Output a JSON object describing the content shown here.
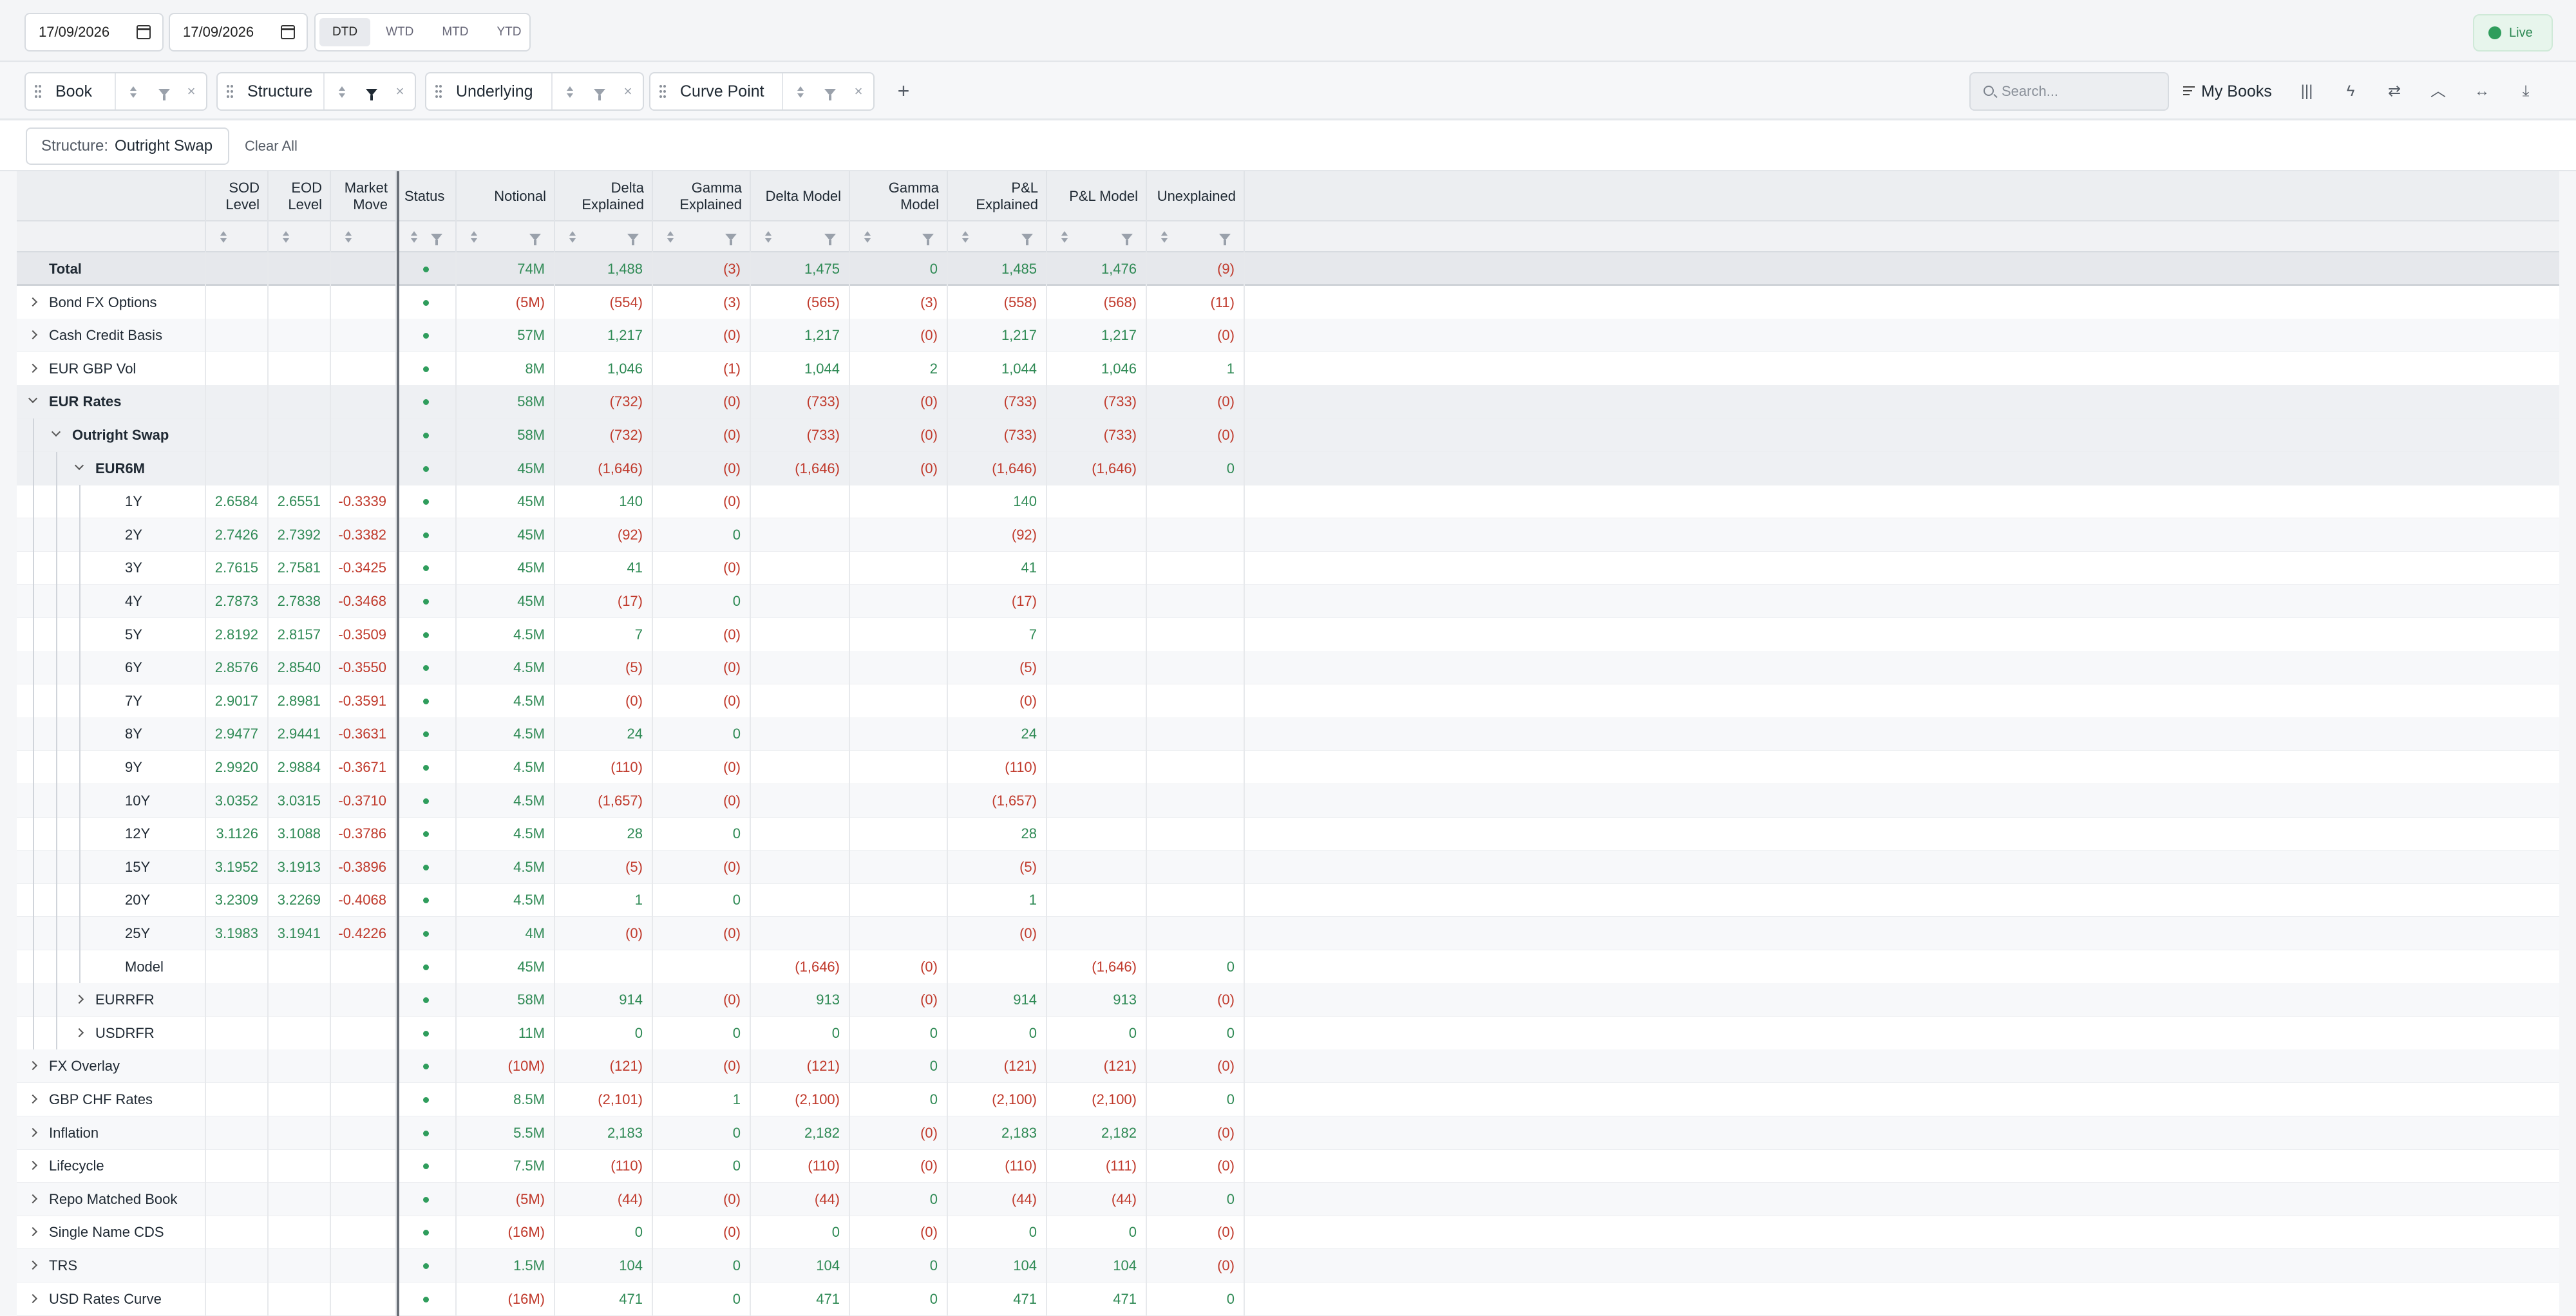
{
  "toolbar": {
    "date_from": "17/09/2026",
    "date_to": "17/09/2026",
    "periods": [
      "DTD",
      "WTD",
      "MTD",
      "YTD"
    ],
    "active_period": "DTD",
    "live_label": "Live",
    "live_color": "#2f9d5c"
  },
  "grouping": {
    "chips": [
      {
        "label": "Book",
        "filter_active": false
      },
      {
        "label": "Structure",
        "filter_active": true
      },
      {
        "label": "Underlying",
        "filter_active": false
      },
      {
        "label": "Curve Point",
        "filter_active": false
      }
    ],
    "add_symbol": "+",
    "search_placeholder": "Search...",
    "my_books_label": "My Books",
    "tool_icons": [
      "columns-icon",
      "lightning-icon",
      "swap-icon",
      "collapse-icon",
      "expand-width-icon",
      "download-icon"
    ]
  },
  "filters": {
    "active": [
      {
        "key": "Structure:",
        "value": "Outright Swap"
      }
    ],
    "clear_all_label": "Clear All"
  },
  "columns": [
    {
      "key": "sod",
      "label": "SOD Level"
    },
    {
      "key": "eod",
      "label": "EOD Level"
    },
    {
      "key": "mkt",
      "label": "Market Move"
    },
    {
      "key": "status",
      "label": "Status"
    },
    {
      "key": "notional",
      "label": "Notional"
    },
    {
      "key": "dexp",
      "label": "Delta Explained"
    },
    {
      "key": "gexp",
      "label": "Gamma Explained"
    },
    {
      "key": "dmod",
      "label": "Delta Model"
    },
    {
      "key": "gmod",
      "label": "Gamma Model"
    },
    {
      "key": "pexp",
      "label": "P&L Explained"
    },
    {
      "key": "pmod",
      "label": "P&L Model"
    },
    {
      "key": "unexp",
      "label": "Unexplained"
    }
  ],
  "colors": {
    "positive": "#2f8a55",
    "negative": "#c0392b"
  },
  "rows": [
    {
      "name": "Total",
      "level": 0,
      "type": "total",
      "v": [
        "",
        "",
        "",
        "",
        "74M",
        "1,488",
        "(3)",
        "1,475",
        "0",
        "1,485",
        "1,476",
        "(9)"
      ]
    },
    {
      "name": "Bond FX Options",
      "level": 0,
      "type": "collapsed",
      "v": [
        "",
        "",
        "",
        "",
        "(5M)",
        "(554)",
        "(3)",
        "(565)",
        "(3)",
        "(558)",
        "(568)",
        "(11)"
      ]
    },
    {
      "name": "Cash Credit Basis",
      "level": 0,
      "type": "collapsed",
      "v": [
        "",
        "",
        "",
        "",
        "57M",
        "1,217",
        "(0)",
        "1,217",
        "(0)",
        "1,217",
        "1,217",
        "(0)"
      ]
    },
    {
      "name": "EUR GBP Vol",
      "level": 0,
      "type": "collapsed",
      "v": [
        "",
        "",
        "",
        "",
        "8M",
        "1,046",
        "(1)",
        "1,044",
        "2",
        "1,044",
        "1,046",
        "1"
      ]
    },
    {
      "name": "EUR Rates",
      "level": 0,
      "type": "expanded",
      "v": [
        "",
        "",
        "",
        "",
        "58M",
        "(732)",
        "(0)",
        "(733)",
        "(0)",
        "(733)",
        "(733)",
        "(0)"
      ]
    },
    {
      "name": "Outright Swap",
      "level": 1,
      "type": "expanded",
      "v": [
        "",
        "",
        "",
        "",
        "58M",
        "(732)",
        "(0)",
        "(733)",
        "(0)",
        "(733)",
        "(733)",
        "(0)"
      ]
    },
    {
      "name": "EUR6M",
      "level": 2,
      "type": "expanded",
      "v": [
        "",
        "",
        "",
        "",
        "45M",
        "(1,646)",
        "(0)",
        "(1,646)",
        "(0)",
        "(1,646)",
        "(1,646)",
        "0"
      ]
    },
    {
      "name": "1Y",
      "level": 3,
      "type": "leaf",
      "v": [
        "2.6584",
        "2.6551",
        "-0.3339",
        "",
        "45M",
        "140",
        "(0)",
        "",
        "",
        "140",
        "",
        ""
      ]
    },
    {
      "name": "2Y",
      "level": 3,
      "type": "leaf",
      "v": [
        "2.7426",
        "2.7392",
        "-0.3382",
        "",
        "45M",
        "(92)",
        "0",
        "",
        "",
        "(92)",
        "",
        ""
      ]
    },
    {
      "name": "3Y",
      "level": 3,
      "type": "leaf",
      "v": [
        "2.7615",
        "2.7581",
        "-0.3425",
        "",
        "45M",
        "41",
        "(0)",
        "",
        "",
        "41",
        "",
        ""
      ]
    },
    {
      "name": "4Y",
      "level": 3,
      "type": "leaf",
      "v": [
        "2.7873",
        "2.7838",
        "-0.3468",
        "",
        "45M",
        "(17)",
        "0",
        "",
        "",
        "(17)",
        "",
        ""
      ]
    },
    {
      "name": "5Y",
      "level": 3,
      "type": "leaf",
      "v": [
        "2.8192",
        "2.8157",
        "-0.3509",
        "",
        "4.5M",
        "7",
        "(0)",
        "",
        "",
        "7",
        "",
        ""
      ]
    },
    {
      "name": "6Y",
      "level": 3,
      "type": "leaf",
      "v": [
        "2.8576",
        "2.8540",
        "-0.3550",
        "",
        "4.5M",
        "(5)",
        "(0)",
        "",
        "",
        "(5)",
        "",
        ""
      ]
    },
    {
      "name": "7Y",
      "level": 3,
      "type": "leaf",
      "v": [
        "2.9017",
        "2.8981",
        "-0.3591",
        "",
        "4.5M",
        "(0)",
        "(0)",
        "",
        "",
        "(0)",
        "",
        ""
      ]
    },
    {
      "name": "8Y",
      "level": 3,
      "type": "leaf",
      "v": [
        "2.9477",
        "2.9441",
        "-0.3631",
        "",
        "4.5M",
        "24",
        "0",
        "",
        "",
        "24",
        "",
        ""
      ]
    },
    {
      "name": "9Y",
      "level": 3,
      "type": "leaf",
      "v": [
        "2.9920",
        "2.9884",
        "-0.3671",
        "",
        "4.5M",
        "(110)",
        "(0)",
        "",
        "",
        "(110)",
        "",
        ""
      ]
    },
    {
      "name": "10Y",
      "level": 3,
      "type": "leaf",
      "v": [
        "3.0352",
        "3.0315",
        "-0.3710",
        "",
        "4.5M",
        "(1,657)",
        "(0)",
        "",
        "",
        "(1,657)",
        "",
        ""
      ]
    },
    {
      "name": "12Y",
      "level": 3,
      "type": "leaf",
      "v": [
        "3.1126",
        "3.1088",
        "-0.3786",
        "",
        "4.5M",
        "28",
        "0",
        "",
        "",
        "28",
        "",
        ""
      ]
    },
    {
      "name": "15Y",
      "level": 3,
      "type": "leaf",
      "v": [
        "3.1952",
        "3.1913",
        "-0.3896",
        "",
        "4.5M",
        "(5)",
        "(0)",
        "",
        "",
        "(5)",
        "",
        ""
      ]
    },
    {
      "name": "20Y",
      "level": 3,
      "type": "leaf",
      "v": [
        "3.2309",
        "3.2269",
        "-0.4068",
        "",
        "4.5M",
        "1",
        "0",
        "",
        "",
        "1",
        "",
        ""
      ]
    },
    {
      "name": "25Y",
      "level": 3,
      "type": "leaf",
      "v": [
        "3.1983",
        "3.1941",
        "-0.4226",
        "",
        "4M",
        "(0)",
        "(0)",
        "",
        "",
        "(0)",
        "",
        ""
      ]
    },
    {
      "name": "Model",
      "level": 3,
      "type": "leaf",
      "v": [
        "",
        "",
        "",
        "",
        "45M",
        "",
        "",
        "(1,646)",
        "(0)",
        "",
        "(1,646)",
        "0"
      ]
    },
    {
      "name": "EURRFR",
      "level": 2,
      "type": "collapsed",
      "v": [
        "",
        "",
        "",
        "",
        "58M",
        "914",
        "(0)",
        "913",
        "(0)",
        "914",
        "913",
        "(0)"
      ]
    },
    {
      "name": "USDRFR",
      "level": 2,
      "type": "collapsed",
      "v": [
        "",
        "",
        "",
        "",
        "11M",
        "0",
        "0",
        "0",
        "0",
        "0",
        "0",
        "0"
      ]
    },
    {
      "name": "FX Overlay",
      "level": 0,
      "type": "collapsed",
      "v": [
        "",
        "",
        "",
        "",
        "(10M)",
        "(121)",
        "(0)",
        "(121)",
        "0",
        "(121)",
        "(121)",
        "(0)"
      ]
    },
    {
      "name": "GBP CHF Rates",
      "level": 0,
      "type": "collapsed",
      "v": [
        "",
        "",
        "",
        "",
        "8.5M",
        "(2,101)",
        "1",
        "(2,100)",
        "0",
        "(2,100)",
        "(2,100)",
        "0"
      ]
    },
    {
      "name": "Inflation",
      "level": 0,
      "type": "collapsed",
      "v": [
        "",
        "",
        "",
        "",
        "5.5M",
        "2,183",
        "0",
        "2,182",
        "(0)",
        "2,183",
        "2,182",
        "(0)"
      ]
    },
    {
      "name": "Lifecycle",
      "level": 0,
      "type": "collapsed",
      "v": [
        "",
        "",
        "",
        "",
        "7.5M",
        "(110)",
        "0",
        "(110)",
        "(0)",
        "(110)",
        "(111)",
        "(0)"
      ]
    },
    {
      "name": "Repo Matched Book",
      "level": 0,
      "type": "collapsed",
      "v": [
        "",
        "",
        "",
        "",
        "(5M)",
        "(44)",
        "(0)",
        "(44)",
        "0",
        "(44)",
        "(44)",
        "0"
      ]
    },
    {
      "name": "Single Name CDS",
      "level": 0,
      "type": "collapsed",
      "v": [
        "",
        "",
        "",
        "",
        "(16M)",
        "0",
        "(0)",
        "0",
        "(0)",
        "0",
        "0",
        "(0)"
      ]
    },
    {
      "name": "TRS",
      "level": 0,
      "type": "collapsed",
      "v": [
        "",
        "",
        "",
        "",
        "1.5M",
        "104",
        "0",
        "104",
        "0",
        "104",
        "104",
        "(0)"
      ]
    },
    {
      "name": "USD Rates Curve",
      "level": 0,
      "type": "collapsed",
      "v": [
        "",
        "",
        "",
        "",
        "(16M)",
        "471",
        "0",
        "471",
        "0",
        "471",
        "471",
        "0"
      ]
    }
  ]
}
